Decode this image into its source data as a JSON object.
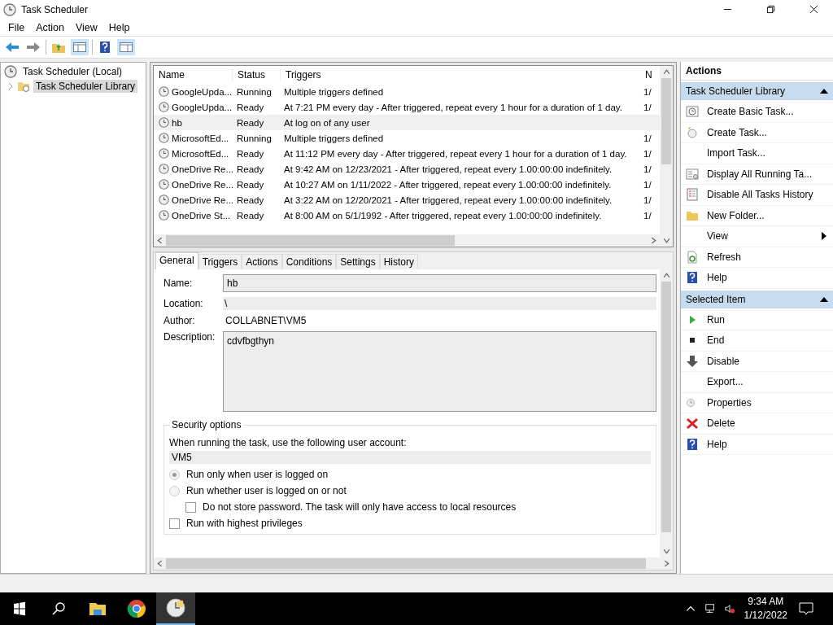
{
  "window": {
    "title": "Task Scheduler"
  },
  "menu": [
    "File",
    "Action",
    "View",
    "Help"
  ],
  "tree": [
    {
      "label": "Task Scheduler (Local)",
      "selected": false,
      "children": [
        {
          "label": "Task Scheduler Library",
          "selected": true,
          "expanded": false
        }
      ]
    }
  ],
  "table": {
    "columns": [
      "Name",
      "Status",
      "Triggers",
      "N"
    ],
    "rows": [
      {
        "name": "GoogleUpda...",
        "status": "Running",
        "triggers": "Multiple triggers defined",
        "column_4": "1/",
        "selected": false
      },
      {
        "name": "GoogleUpda...",
        "status": "Ready",
        "triggers": "At 7:21 PM every day - After triggered, repeat every 1 hour for a duration of 1 day.",
        "column_4": "1/",
        "selected": false
      },
      {
        "name": "hb",
        "status": "Ready",
        "triggers": "At log on of any user",
        "selected": true
      },
      {
        "name": "MicrosoftEd...",
        "status": "Running",
        "triggers": "Multiple triggers defined",
        "column_4": "1/",
        "selected": false
      },
      {
        "name": "MicrosoftEd...",
        "status": "Ready",
        "triggers": "At 11:12 PM every day - After triggered, repeat every 1 hour for a duration of 1 day.",
        "column_4": "1/",
        "selected": false
      },
      {
        "name": "OneDrive Re...",
        "status": "Ready",
        "triggers": "At 9:42 AM on 12/23/2021 - After triggered, repeat every 1.00:00:00 indefinitely.",
        "column_4": "1/",
        "selected": false
      },
      {
        "name": "OneDrive Re...",
        "status": "Ready",
        "triggers": "At 10:27 AM on 1/11/2022 - After triggered, repeat every 1.00:00:00 indefinitely.",
        "column_4": "1/",
        "selected": false
      },
      {
        "name": "OneDrive Re...",
        "status": "Ready",
        "triggers": "At 3:22 AM on 12/20/2021 - After triggered, repeat every 1.00:00:00 indefinitely.",
        "column_4": "1/",
        "selected": false
      },
      {
        "name": "OneDrive St...",
        "status": "Ready",
        "triggers": "At 8:00 AM on 5/1/1992 - After triggered, repeat every 1.00:00:00 indefinitely.",
        "column_4": "1/",
        "selected": false
      }
    ]
  },
  "detail": {
    "tabs": [
      {
        "label": "General",
        "selected": true
      },
      {
        "label": "Triggers",
        "selected": false
      },
      {
        "label": "Actions",
        "selected": false
      },
      {
        "label": "Conditions",
        "selected": false
      },
      {
        "label": "Settings",
        "selected": false
      },
      {
        "label": "History",
        "selected": false
      }
    ],
    "name_label": "Name:",
    "name": "hb",
    "location_label": "Location:",
    "location": "\\",
    "author_label": "Author:",
    "author": "COLLABNET\\VM5",
    "description_label": "Description:",
    "description": "cdvfbgthyn",
    "security": {
      "title": "Security options",
      "account_label": "When running the task, use the following user account:",
      "account": "VM5",
      "options": [
        {
          "kind": "radio",
          "label": "Run only when user is logged on",
          "selected": true,
          "disabled": true
        },
        {
          "kind": "radio",
          "label": "Run whether user is logged on or not",
          "selected": false,
          "disabled": true
        },
        {
          "kind": "checkbox",
          "label": "Do not store password.  The task will only have access to local resources",
          "checked": false,
          "indent": true
        },
        {
          "kind": "checkbox",
          "label": "Run with highest privileges",
          "checked": false,
          "indent": false
        }
      ]
    }
  },
  "actions": {
    "title": "Actions",
    "sections": [
      {
        "title": "Task Scheduler Library",
        "expanded": true,
        "items": [
          {
            "label": "Create Basic Task..."
          },
          {
            "label": "Create Task..."
          },
          {
            "label": "Import Task..."
          },
          {
            "label": "Display All Running Ta..."
          },
          {
            "label": "Disable All Tasks History"
          },
          {
            "label": "New Folder..."
          },
          {
            "label": "View",
            "submenu": true
          },
          {
            "label": "Refresh"
          },
          {
            "label": "Help"
          }
        ]
      },
      {
        "title": "Selected Item",
        "expanded": true,
        "items": [
          {
            "label": "Run"
          },
          {
            "label": "End"
          },
          {
            "label": "Disable"
          },
          {
            "label": "Export..."
          },
          {
            "label": "Properties"
          },
          {
            "label": "Delete"
          },
          {
            "label": "Help"
          }
        ]
      }
    ]
  },
  "taskbar": {
    "apps": [
      {
        "selected": false
      },
      {
        "selected": false
      },
      {
        "selected": true
      }
    ],
    "time": "9:34 AM",
    "date": "1/12/2022"
  }
}
